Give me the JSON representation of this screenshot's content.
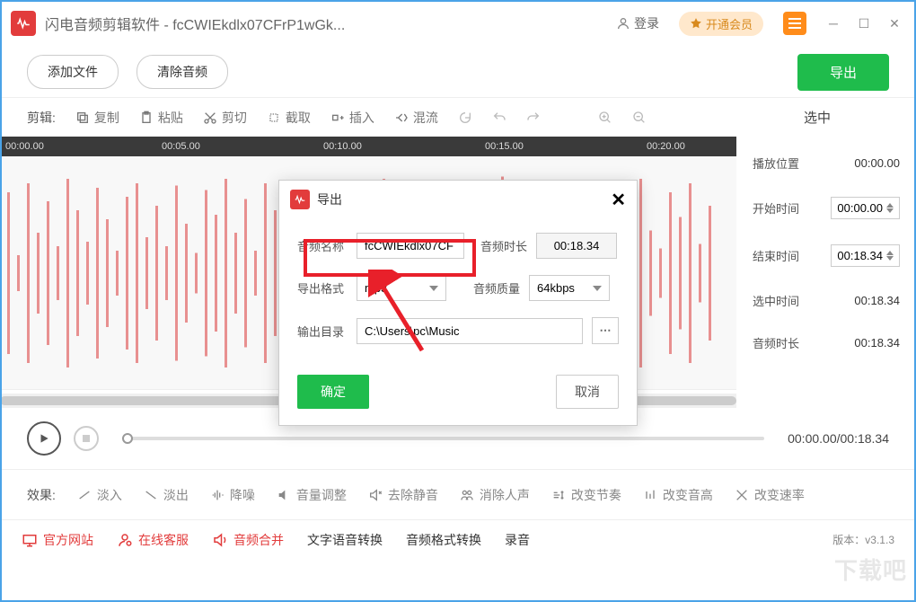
{
  "titlebar": {
    "app_name": "闪电音频剪辑软件",
    "file_name": " - fcCWIEkdlx07CFrP1wGk...",
    "login": "登录",
    "vip": "开通会员"
  },
  "top": {
    "add_file": "添加文件",
    "clear_audio": "清除音频",
    "export": "导出"
  },
  "toolbar": {
    "label": "剪辑:",
    "copy": "复制",
    "paste": "粘贴",
    "cut": "剪切",
    "crop": "截取",
    "insert": "插入",
    "mix": "混流",
    "selected": "选中"
  },
  "timeline": {
    "t0": "00:00.00",
    "t1": "00:05.00",
    "t2": "00:10.00",
    "t3": "00:15.00",
    "t4": "00:20.00"
  },
  "sidebar": {
    "play_pos_label": "播放位置",
    "play_pos": "00:00.00",
    "start_label": "开始时间",
    "start": "00:00.00",
    "end_label": "结束时间",
    "end": "00:18.34",
    "sel_label": "选中时间",
    "sel": "00:18.34",
    "dur_label": "音频时长",
    "dur": "00:18.34"
  },
  "player": {
    "time": "00:00.00/00:18.34"
  },
  "effects": {
    "label": "效果:",
    "fade_in": "淡入",
    "fade_out": "淡出",
    "denoise": "降噪",
    "volume": "音量调整",
    "silence": "去除静音",
    "vocals": "消除人声",
    "tempo": "改变节奏",
    "pitch": "改变音高",
    "speed": "改变速率"
  },
  "bottom": {
    "site": "官方网站",
    "support": "在线客服",
    "merge": "音频合并",
    "tts": "文字语音转换",
    "format": "音频格式转换",
    "record": "录音",
    "version": "版本：v3.1.3"
  },
  "modal": {
    "title": "导出",
    "name_label": "音频名称",
    "name_value": "fcCWIEkdlx07CF",
    "duration_label": "音频时长",
    "duration_value": "00:18.34",
    "format_label": "导出格式",
    "format_value": "mp3",
    "quality_label": "音频质量",
    "quality_value": "64kbps",
    "outdir_label": "输出目录",
    "outdir_value": "C:\\Users\\pc\\Music",
    "ok": "确定",
    "cancel": "取消"
  },
  "watermark": "下载吧"
}
